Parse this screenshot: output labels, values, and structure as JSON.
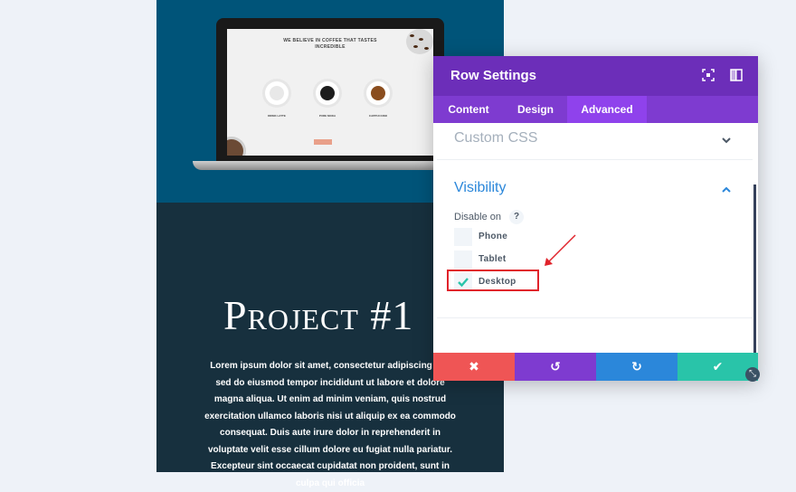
{
  "page": {
    "laptop": {
      "headline": "WE BELIEVE IN COFFEE THAT TASTES INCREDIBLE",
      "items": [
        "DRINK LATTE",
        "PURE MOKA",
        "CAPPUCCINO"
      ]
    },
    "title": "Project #1",
    "body": "Lorem ipsum dolor sit amet, consectetur adipiscing elit, sed do eiusmod tempor incididunt ut labore et dolore magna aliqua. Ut enim ad minim veniam, quis nostrud exercitation ullamco laboris nisi ut aliquip ex ea commodo consequat. Duis aute irure dolor in reprehenderit in voluptate velit esse cillum dolore eu fugiat nulla pariatur. Excepteur sint occaecat cupidatat non proident, sunt in culpa qui officia"
  },
  "modal": {
    "title": "Row Settings",
    "header_icons": [
      "fullscreen-icon",
      "sidebar-toggle-icon"
    ],
    "tabs": [
      {
        "label": "Content",
        "active": false
      },
      {
        "label": "Design",
        "active": false
      },
      {
        "label": "Advanced",
        "active": true
      }
    ],
    "sections": {
      "custom_css": {
        "title": "Custom CSS",
        "expanded": false
      },
      "visibility": {
        "title": "Visibility",
        "expanded": true,
        "disable_on_label": "Disable on",
        "help": "?",
        "options": [
          {
            "label": "Phone",
            "checked": false
          },
          {
            "label": "Tablet",
            "checked": false
          },
          {
            "label": "Desktop",
            "checked": true
          }
        ]
      }
    },
    "footer": {
      "buttons": [
        {
          "name": "discard",
          "icon": "✖",
          "color": "#ef5555"
        },
        {
          "name": "undo",
          "icon": "↺",
          "color": "#7e3bd0"
        },
        {
          "name": "redo",
          "icon": "↻",
          "color": "#2b87da"
        },
        {
          "name": "save",
          "icon": "✔",
          "color": "#29c4a9"
        }
      ]
    }
  },
  "colors": {
    "purple_header": "#6c2eb9",
    "purple_tabs": "#7e3bd0",
    "blue_accent": "#2b87da",
    "red_annotation": "#e0232b"
  }
}
